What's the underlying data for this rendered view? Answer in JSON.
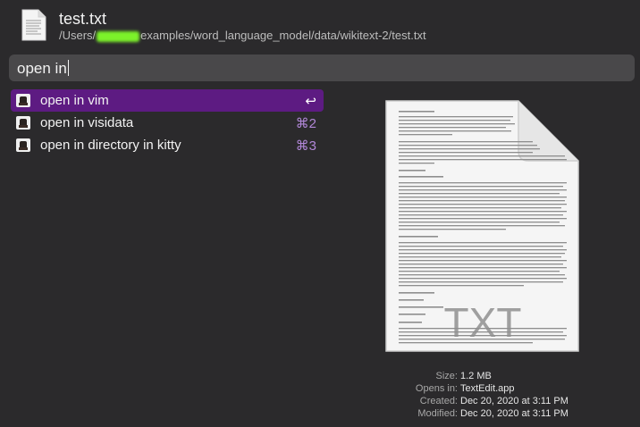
{
  "header": {
    "title": "test.txt",
    "path_prefix": "/Users/",
    "path_suffix": "examples/word_language_model/data/wikitext-2/test.txt"
  },
  "query": {
    "text": "open in"
  },
  "results": [
    {
      "label": "open in vim",
      "shortcut": "↩",
      "selected": true
    },
    {
      "label": "open in visidata",
      "shortcut": "⌘2",
      "selected": false
    },
    {
      "label": "open in directory in kitty",
      "shortcut": "⌘3",
      "selected": false
    }
  ],
  "preview": {
    "icon_badge": "TXT",
    "meta": [
      {
        "key": "Size:",
        "value": "1.2 MB"
      },
      {
        "key": "Opens in:",
        "value": "TextEdit.app"
      },
      {
        "key": "Created:",
        "value": "Dec 20, 2020 at 3:11 PM"
      },
      {
        "key": "Modified:",
        "value": "Dec 20, 2020 at 3:11 PM"
      }
    ]
  },
  "colors": {
    "selection": "#5d1b82",
    "shortcut": "#b187d8",
    "background": "#2b2a2c"
  }
}
